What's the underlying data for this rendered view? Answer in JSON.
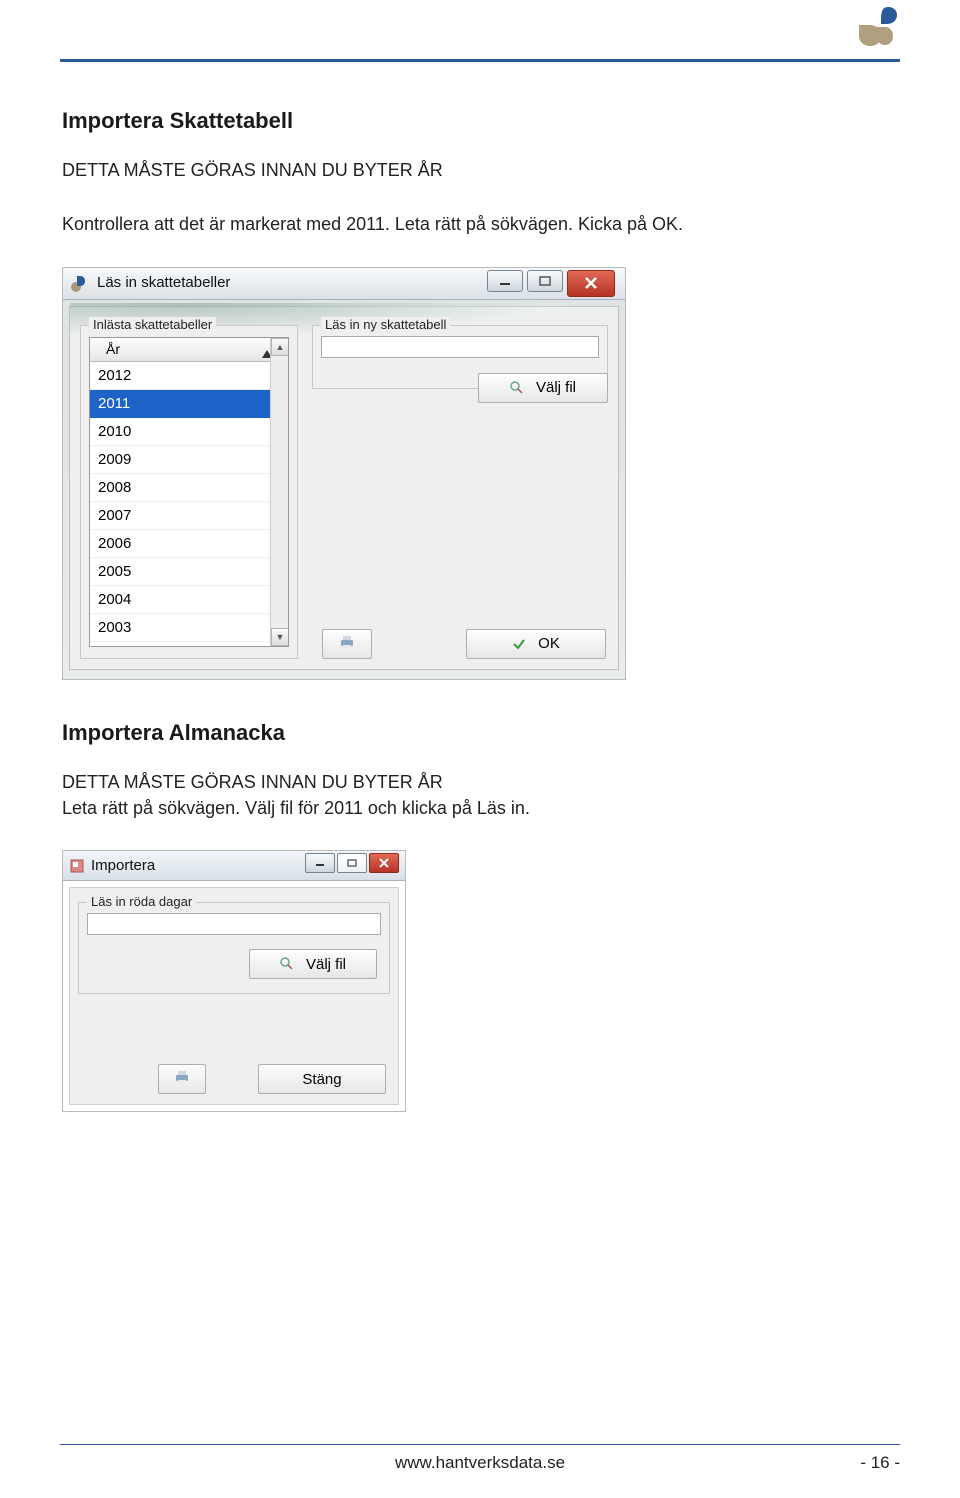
{
  "section1": {
    "heading": "Importera Skattetabell",
    "line1": "DETTA MÅSTE GÖRAS INNAN DU BYTER ÅR",
    "line2": "Kontrollera att det är markerat med 2011. Leta rätt på sökvägen. Kicka på OK."
  },
  "shot1": {
    "title": "Läs in skattetabeller",
    "group_left": "Inlästa skattetabeller",
    "group_right": "Läs in ny skattetabell",
    "list_header": "År",
    "years": [
      "2012",
      "2011",
      "2010",
      "2009",
      "2008",
      "2007",
      "2006",
      "2005",
      "2004",
      "2003"
    ],
    "selected_year": "2011",
    "btn_valj": "Välj fil",
    "btn_ok": "OK"
  },
  "section2": {
    "heading": "Importera Almanacka",
    "line1": "DETTA MÅSTE GÖRAS INNAN DU BYTER ÅR",
    "line2": "Leta rätt på sökvägen. Välj fil för 2011 och klicka på Läs in."
  },
  "shot2": {
    "title": "Importera",
    "group": "Läs in röda dagar",
    "btn_valj": "Välj fil",
    "btn_stang": "Stäng"
  },
  "footer": {
    "url": "www.hantverksdata.se",
    "page": "- 16 -"
  }
}
